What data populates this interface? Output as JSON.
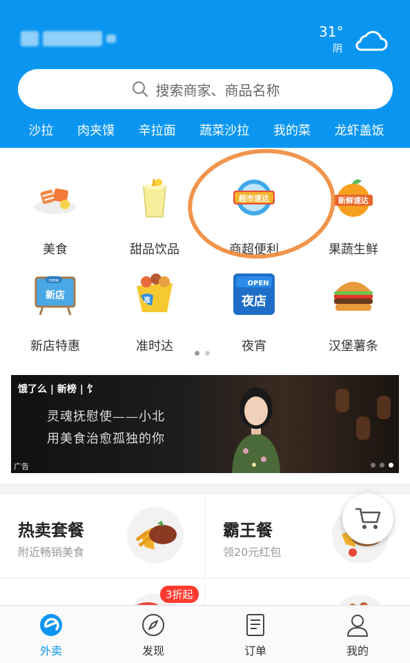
{
  "header": {
    "weather": {
      "temperature": "31°",
      "condition": "阴",
      "icon": "cloud-icon"
    }
  },
  "search": {
    "placeholder": "搜索商家、商品名称",
    "icon": "search-icon"
  },
  "hot_words": [
    "沙拉",
    "肉夹馍",
    "辛拉面",
    "蔬菜沙拉",
    "我的菜",
    "龙虾盖饭"
  ],
  "categories": [
    {
      "label": "美食",
      "icon": "salmon-dish-icon"
    },
    {
      "label": "甜品饮品",
      "icon": "drink-cup-icon"
    },
    {
      "label": "商超便利",
      "icon": "supermarket-icon",
      "icon_text": "超市速达"
    },
    {
      "label": "果蔬生鲜",
      "icon": "fresh-fruit-icon",
      "icon_text": "新鲜速达"
    },
    {
      "label": "新店特惠",
      "icon": "new-store-icon",
      "icon_text": "新店",
      "icon_tag": "new"
    },
    {
      "label": "准时达",
      "icon": "on-time-icon",
      "icon_text": "准"
    },
    {
      "label": "夜宵",
      "icon": "night-store-icon",
      "icon_text": "夜店",
      "icon_tag": "OPEN"
    },
    {
      "label": "汉堡薯条",
      "icon": "burger-icon"
    }
  ],
  "category_pages": {
    "count": 2,
    "current": 1
  },
  "banner": {
    "brand_text": "饿了么 | 新榜 | 饣",
    "line1": "灵魂抚慰使——小北",
    "line2": "用美食治愈孤独的你",
    "ad_label": "广告",
    "pages": 3,
    "current": 3
  },
  "promos": [
    {
      "title": "热卖套餐",
      "subtitle": "附近畅销美食",
      "icon": "steak-fries-icon"
    },
    {
      "title": "霸王餐",
      "subtitle": "领20元红包",
      "icon": "steak-plate-icon"
    }
  ],
  "promo_badge": "3折起",
  "cart": {
    "icon": "cart-icon"
  },
  "tabs": [
    {
      "label": "外卖",
      "icon": "eleme-logo-icon",
      "active": true
    },
    {
      "label": "发现",
      "icon": "compass-icon",
      "active": false
    },
    {
      "label": "订单",
      "icon": "order-list-icon",
      "active": false
    },
    {
      "label": "我的",
      "icon": "person-icon",
      "active": false
    }
  ],
  "colors": {
    "brand_blue": "#0a96f0",
    "annotation_orange": "#f08a3a",
    "badge_red": "#ff3b30"
  }
}
